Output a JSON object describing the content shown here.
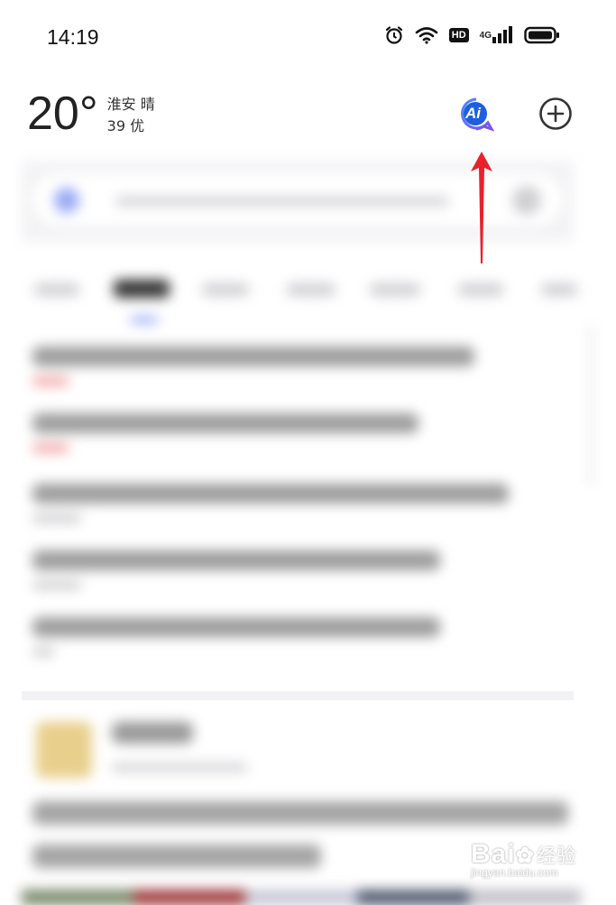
{
  "status_bar": {
    "time": "14:19",
    "icons": [
      "alarm-icon",
      "wifi-icon",
      "hd-badge",
      "signal-4g-icon",
      "battery-icon"
    ],
    "hd_label": "HD",
    "network_label": "4G"
  },
  "weather": {
    "temperature": "20°",
    "city": "淮安",
    "condition": "晴",
    "aqi": "39 优"
  },
  "header_actions": {
    "ai_label": "Ai",
    "ai_color": "#3b6cf0",
    "plus_icon": "plus-circle-icon"
  },
  "annotation": {
    "arrow_color": "#e8222b"
  },
  "watermark": {
    "brand": "Bai",
    "brand_suffix": "百",
    "cn": "经验",
    "url": "jingyan.baidu.com"
  }
}
